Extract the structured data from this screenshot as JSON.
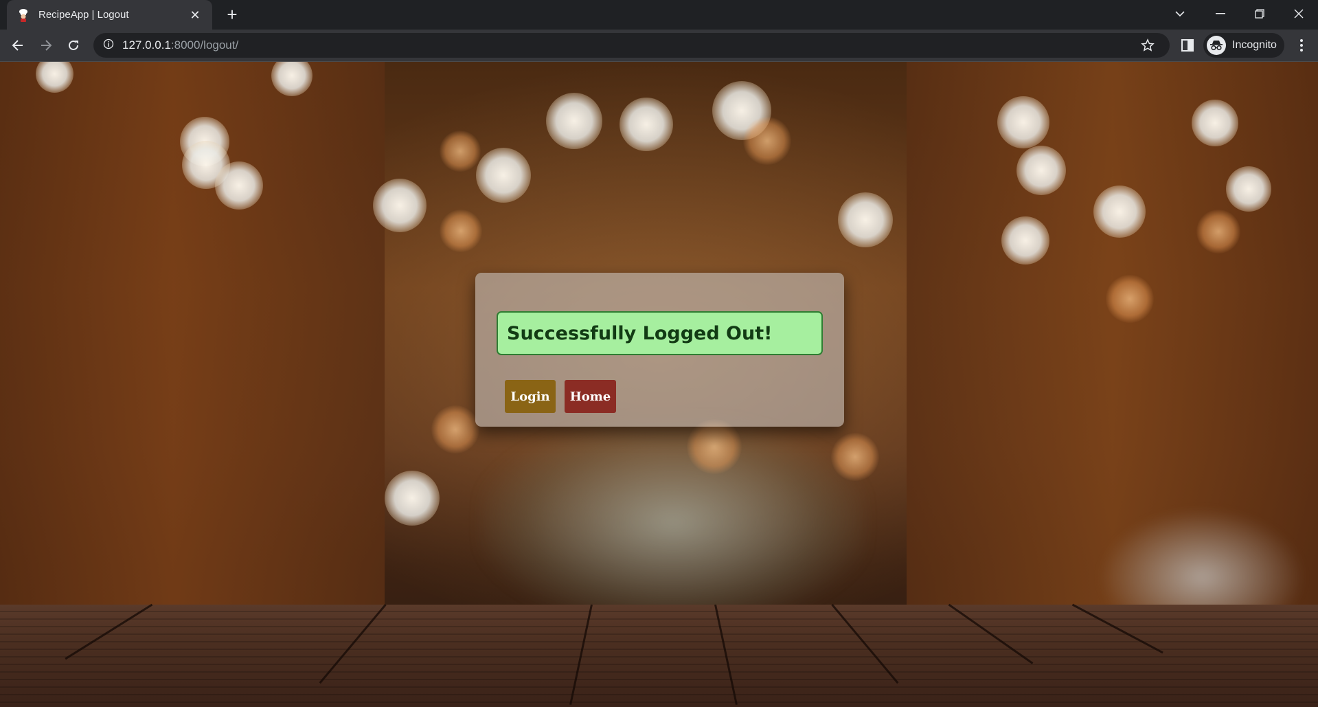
{
  "browser": {
    "tab_title": "RecipeApp | Logout",
    "tab_close": "✕",
    "new_tab": "+",
    "url_host": "127.0.0.1",
    "url_path": ":8000/logout/",
    "incognito_label": "Incognito"
  },
  "logout_card": {
    "message": "Successfully Logged Out!",
    "login_label": "Login",
    "home_label": "Home"
  },
  "colors": {
    "success_bg": "#a6ef9f",
    "success_border": "#2e7d32",
    "login_button": "#8a6415",
    "home_button": "#8b2c24"
  },
  "icons": [
    "chef-favicon-icon",
    "close-icon",
    "plus-icon",
    "chevron-down-icon",
    "minimize-icon",
    "restore-icon",
    "window-close-icon",
    "back-arrow-icon",
    "forward-arrow-icon",
    "reload-icon",
    "info-icon",
    "star-icon",
    "side-panel-icon",
    "incognito-icon",
    "more-vert-icon"
  ]
}
